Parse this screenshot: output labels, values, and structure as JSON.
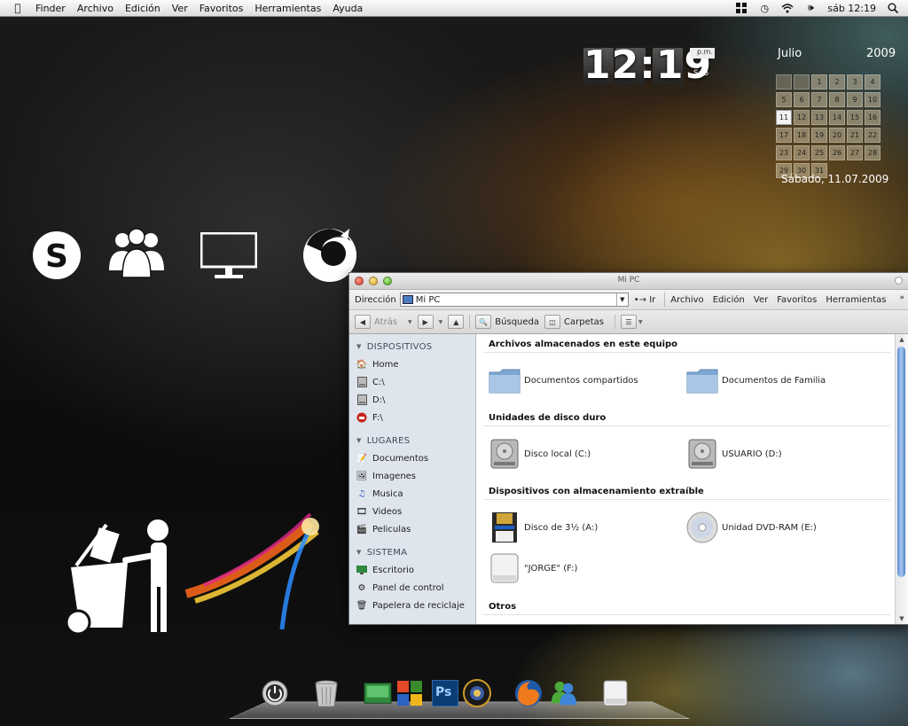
{
  "menubar": {
    "items": [
      "Finder",
      "Archivo",
      "Edición",
      "Ver",
      "Favoritos",
      "Herramientas",
      "Ayuda"
    ],
    "clock": "sáb 12:19"
  },
  "clock_widget": {
    "time": "12:19",
    "ampm": "p.m.",
    "day": "Sáb"
  },
  "calendar": {
    "month": "Julio",
    "year": "2009",
    "days": [
      "",
      "",
      "1",
      "2",
      "3",
      "4",
      "5",
      "6",
      "7",
      "8",
      "9",
      "10",
      "11",
      "12",
      "13",
      "14",
      "15",
      "16",
      "17",
      "18",
      "19",
      "20",
      "21",
      "22",
      "23",
      "24",
      "25",
      "26",
      "27",
      "28",
      "29",
      "30",
      "31"
    ],
    "today": "11",
    "date_label": "Sábado, 11.07.2009"
  },
  "window": {
    "title": "Mi PC",
    "address_label": "Dirección",
    "address_value": "Mi PC",
    "go_label": "Ir",
    "menus": [
      "Archivo",
      "Edición",
      "Ver",
      "Favoritos",
      "Herramientas"
    ],
    "toolbar": {
      "back": "Atrás",
      "search": "Búsqueda",
      "folders": "Carpetas"
    },
    "sidebar": {
      "sections": [
        {
          "title": "DISPOSITIVOS",
          "items": [
            "Home",
            "C:\\",
            "D:\\",
            "F:\\"
          ]
        },
        {
          "title": "LUGARES",
          "items": [
            "Documentos",
            "Imagenes",
            "Musica",
            "Videos",
            "Peliculas"
          ]
        },
        {
          "title": "SISTEMA",
          "items": [
            "Escritorio",
            "Panel de control",
            "Papelera de reciclaje"
          ]
        }
      ]
    },
    "groups": [
      {
        "title": "Archivos almacenados en este equipo",
        "items": [
          "Documentos compartidos",
          "Documentos de Familia"
        ]
      },
      {
        "title": "Unidades de disco duro",
        "items": [
          "Disco local (C:)",
          "USUARIO (D:)"
        ]
      },
      {
        "title": "Dispositivos con almacenamiento extraíble",
        "items": [
          "Disco de 3½ (A:)",
          "Unidad DVD-RAM (E:)",
          "\"JORGE\" (F:)"
        ]
      },
      {
        "title": "Otros",
        "items": []
      }
    ]
  },
  "dock": {
    "icons": [
      "power-icon",
      "trash-icon",
      "app-green-icon",
      "office-icon",
      "photoshop-icon",
      "game-icon",
      "firefox-icon",
      "messenger-icon",
      "drive-icon"
    ],
    "photoshop_label": "Ps"
  },
  "colors": {
    "accent_blue": "#4d7fc8",
    "menubar": "#e8e8e8"
  }
}
